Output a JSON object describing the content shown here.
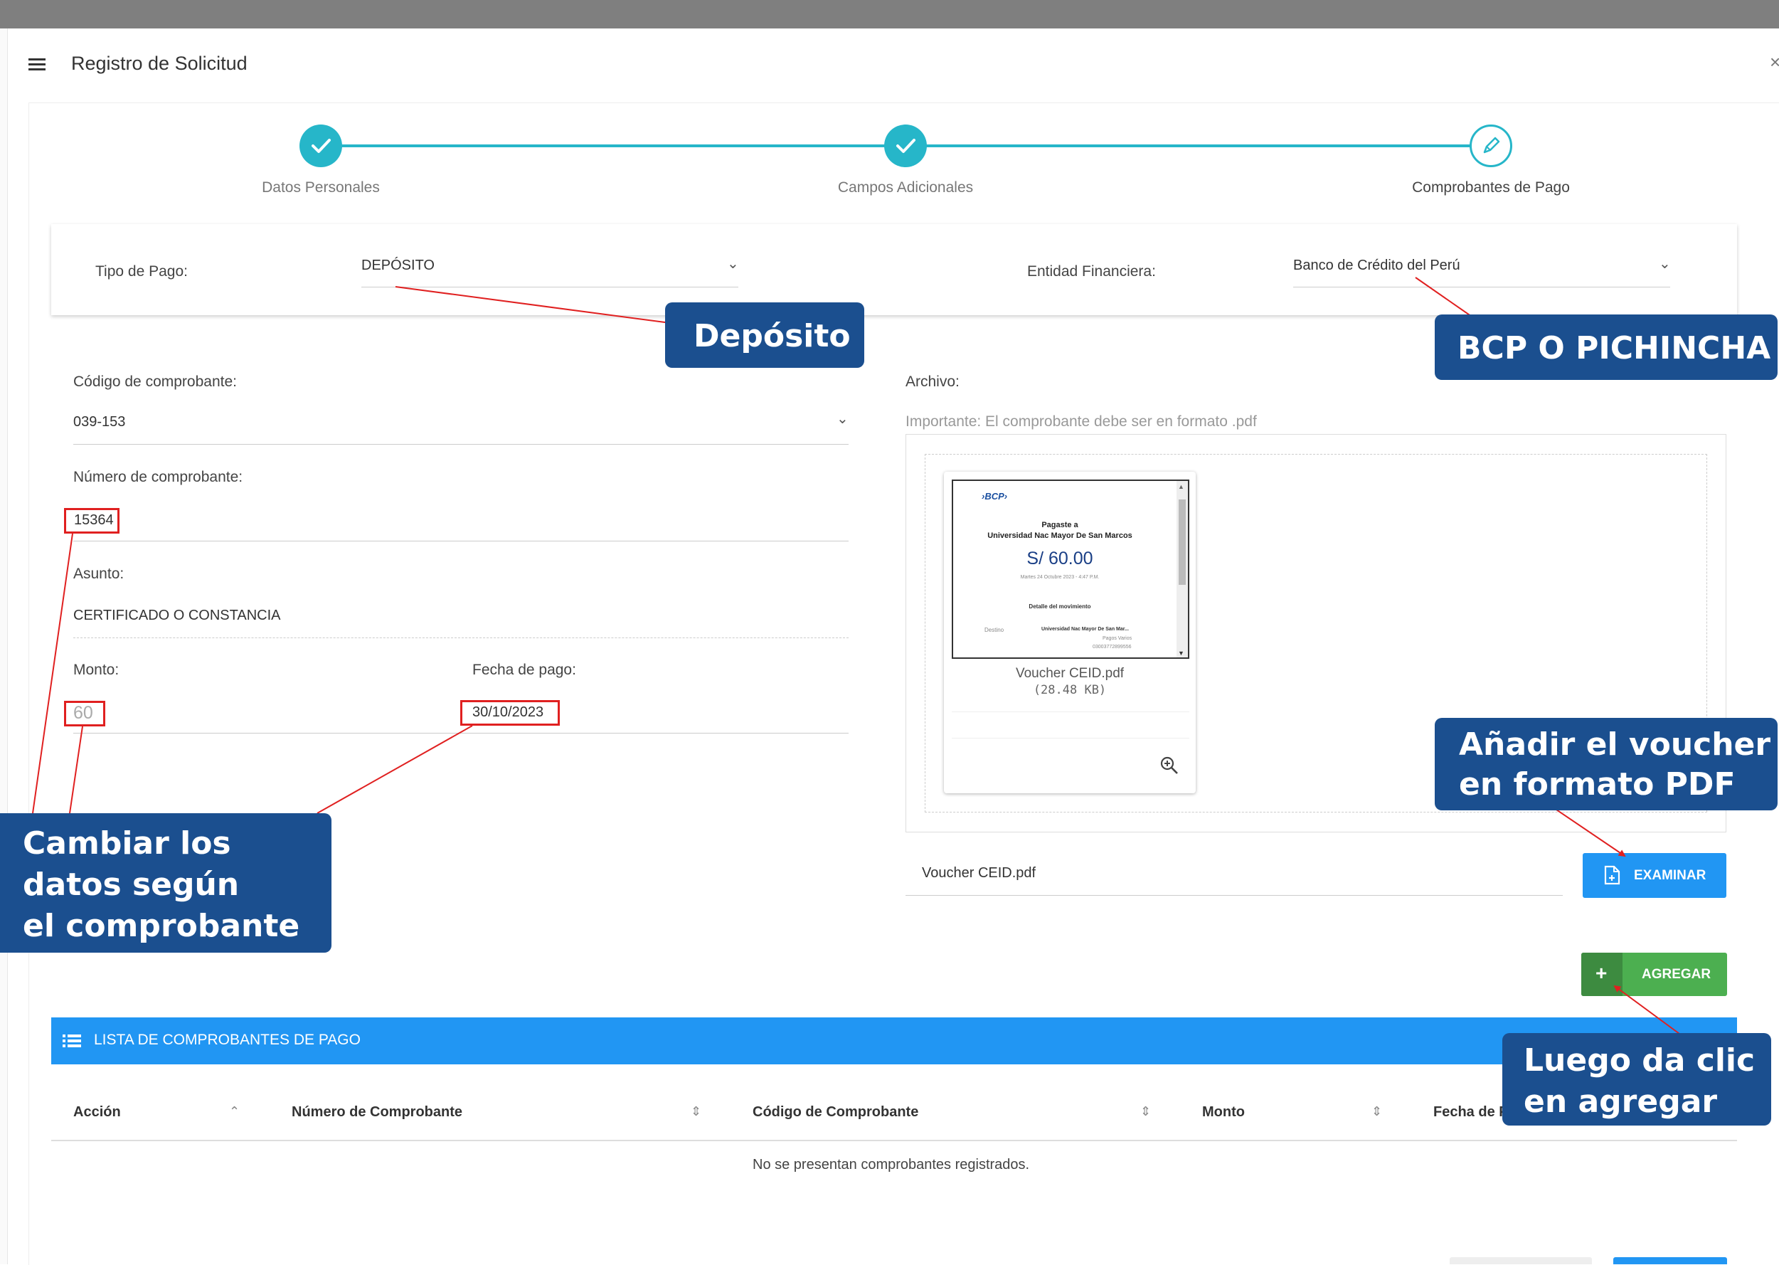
{
  "window": {
    "title": "Registro de Solicitud",
    "close_glyph": "×"
  },
  "stepper": {
    "steps": [
      {
        "label": "Datos Personales",
        "state": "done"
      },
      {
        "label": "Campos Adicionales",
        "state": "done"
      },
      {
        "label": "Comprobantes de Pago",
        "state": "current"
      }
    ]
  },
  "payment": {
    "tipo_label": "Tipo de Pago:",
    "tipo_value": "DEPÓSITO",
    "entidad_label": "Entidad Financiera:",
    "entidad_value": "Banco de Crédito del Perú"
  },
  "form": {
    "codigo_label": "Código de comprobante:",
    "codigo_value": "039-153",
    "numero_label": "Número de comprobante:",
    "numero_value": "15364",
    "asunto_label": "Asunto:",
    "asunto_value": "CERTIFICADO O CONSTANCIA",
    "monto_label": "Monto:",
    "monto_value": "60",
    "fecha_label": "Fecha de pago:",
    "fecha_value": "30/10/2023"
  },
  "file": {
    "archivo_label": "Archivo:",
    "note": "Importante: El comprobante debe ser en formato .pdf",
    "preview_name": "Voucher CEID.pdf",
    "preview_size": "(28.48 KB)",
    "input_value": "Voucher CEID.pdf",
    "examinar_label": "EXAMINAR",
    "agregar_label": "AGREGAR",
    "agregar_plus": "+"
  },
  "receipt": {
    "logo": "›BCP›",
    "line1": "Pagaste a",
    "line2": "Universidad Nac Mayor De San Marcos",
    "amount": "S/  60.00",
    "date": "Martes 24 Octubre 2023 - 4:47 P.M.",
    "detail": "Detalle del movimiento",
    "dest_label": "Destino",
    "dest_value": "Universidad Nac Mayor De San Mar...",
    "dest_sub": "Pagos Varios",
    "dest_num": "03003772899556"
  },
  "table": {
    "title": "LISTA DE COMPROBANTES DE PAGO",
    "columns": [
      "Acción",
      "Número de Comprobante",
      "Código de Comprobante",
      "Monto",
      "Fecha de P"
    ],
    "empty_message": "No se presentan comprobantes registrados."
  },
  "callouts": {
    "deposito": "Depósito",
    "bcp": "BCP O PICHINCHA",
    "cambiar": "Cambiar los\ndatos según\nel comprobante",
    "voucher": "Añadir el voucher\nen formato PDF",
    "agregar": "Luego da clic\nen agregar"
  },
  "colors": {
    "teal": "#26b6c9",
    "blue": "#2196f3",
    "green": "#4caf50",
    "callout": "#1b4f8f",
    "red": "#e02020"
  }
}
